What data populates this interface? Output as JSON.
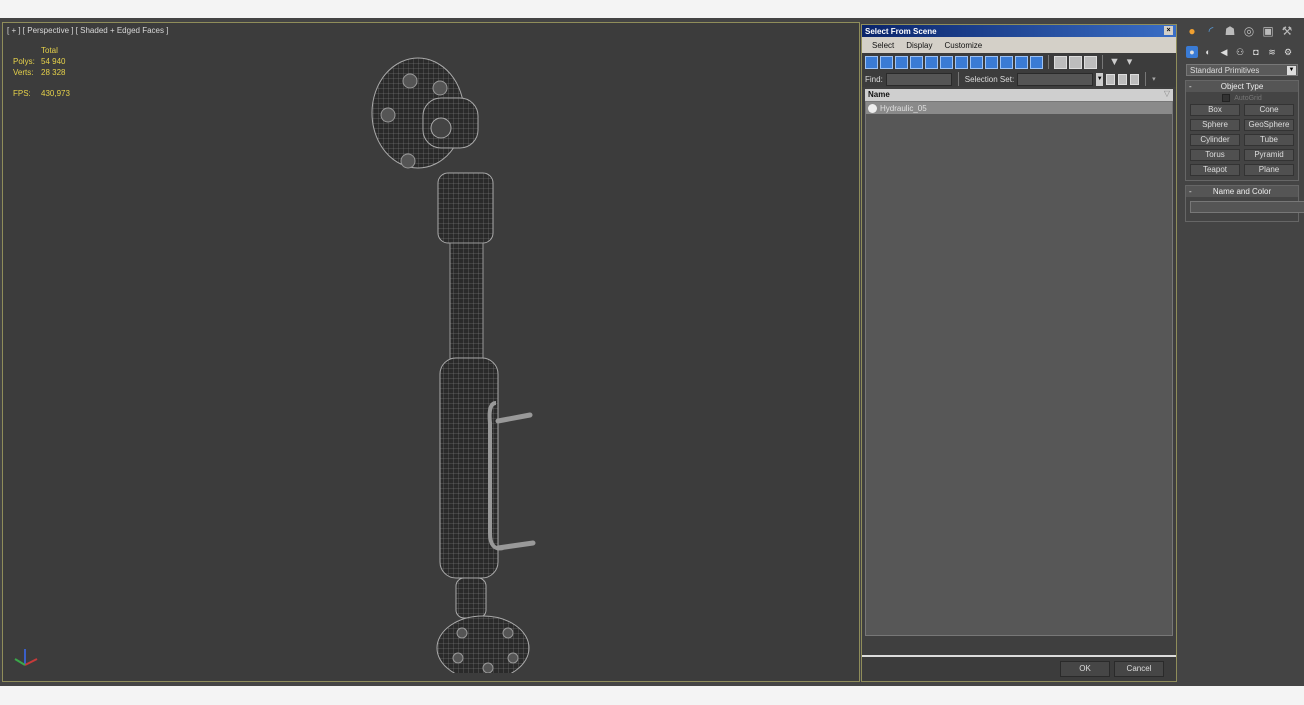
{
  "viewport": {
    "label": "[ + ] [ Perspective ] [ Shaded + Edged Faces ]",
    "stats": {
      "header": "Total",
      "polys_label": "Polys:",
      "polys_value": "54 940",
      "verts_label": "Verts:",
      "verts_value": "28 328",
      "fps_label": "FPS:",
      "fps_value": "430,973"
    },
    "stats_color": "#e6d24a"
  },
  "dialog": {
    "title": "Select From Scene",
    "close_icon": "×",
    "menu": [
      "Select",
      "Display",
      "Customize"
    ],
    "find_label": "Find:",
    "find_value": "",
    "selection_set_label": "Selection Set:",
    "selection_set_value": "",
    "column_header": "Name",
    "items": [
      {
        "name": "Hydraulic_05",
        "icon": "geometry-object-icon"
      }
    ],
    "ok_label": "OK",
    "cancel_label": "Cancel"
  },
  "command_panel": {
    "tabs": [
      "create",
      "modify",
      "hierarchy",
      "motion",
      "display",
      "utilities"
    ],
    "subtabs": [
      "geometry",
      "shapes",
      "lights",
      "cameras",
      "helpers",
      "space-warps",
      "systems"
    ],
    "category": "Standard Primitives",
    "object_type_title": "Object Type",
    "autogrid_label": "AutoGrid",
    "autogrid_checked": false,
    "primitives": [
      "Box",
      "Cone",
      "Sphere",
      "GeoSphere",
      "Cylinder",
      "Tube",
      "Torus",
      "Pyramid",
      "Teapot",
      "Plane"
    ],
    "name_color_title": "Name and Color",
    "name_value": "",
    "object_color": "#c8287a"
  }
}
